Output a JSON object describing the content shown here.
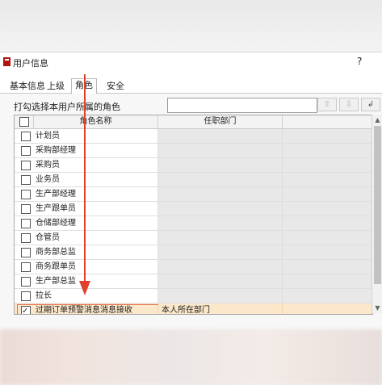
{
  "window": {
    "title": "用户信息",
    "help": "?"
  },
  "tabs": [
    {
      "label": "基本信息",
      "active": false
    },
    {
      "label": "上级",
      "active": false
    },
    {
      "label": "角色",
      "active": true
    },
    {
      "label": "安全",
      "active": false
    }
  ],
  "prompt": "打勾选择本用户所属的角色",
  "filter": {
    "value": "",
    "placeholder": ""
  },
  "nav_buttons": [
    "⇧",
    "⇩",
    "↲"
  ],
  "grid": {
    "headers": [
      "",
      "角色名称",
      "任职部门",
      ""
    ],
    "rows": [
      {
        "checked": false,
        "name": "计划员",
        "dept": ""
      },
      {
        "checked": false,
        "name": "采购部经理",
        "dept": ""
      },
      {
        "checked": false,
        "name": "采购员",
        "dept": ""
      },
      {
        "checked": false,
        "name": "业务员",
        "dept": ""
      },
      {
        "checked": false,
        "name": "生产部经理",
        "dept": ""
      },
      {
        "checked": false,
        "name": "生产跟单员",
        "dept": ""
      },
      {
        "checked": false,
        "name": "仓储部经理",
        "dept": ""
      },
      {
        "checked": false,
        "name": "仓管员",
        "dept": ""
      },
      {
        "checked": false,
        "name": "商务部总监",
        "dept": ""
      },
      {
        "checked": false,
        "name": "商务跟单员",
        "dept": ""
      },
      {
        "checked": false,
        "name": "生产部总监",
        "dept": ""
      },
      {
        "checked": false,
        "name": "拉长",
        "dept": ""
      },
      {
        "checked": true,
        "name": "过期订单预警消息消息接收",
        "dept": "本人所在部门",
        "selected": true
      }
    ]
  },
  "colors": {
    "selected_row": "#fbe7c9",
    "annotation": "#e0412f",
    "app_icon": "#b31212"
  },
  "icons": {
    "app": "app-logo-icon",
    "scroll_up": "scroll-up-icon",
    "scroll_down": "scroll-down-icon"
  }
}
